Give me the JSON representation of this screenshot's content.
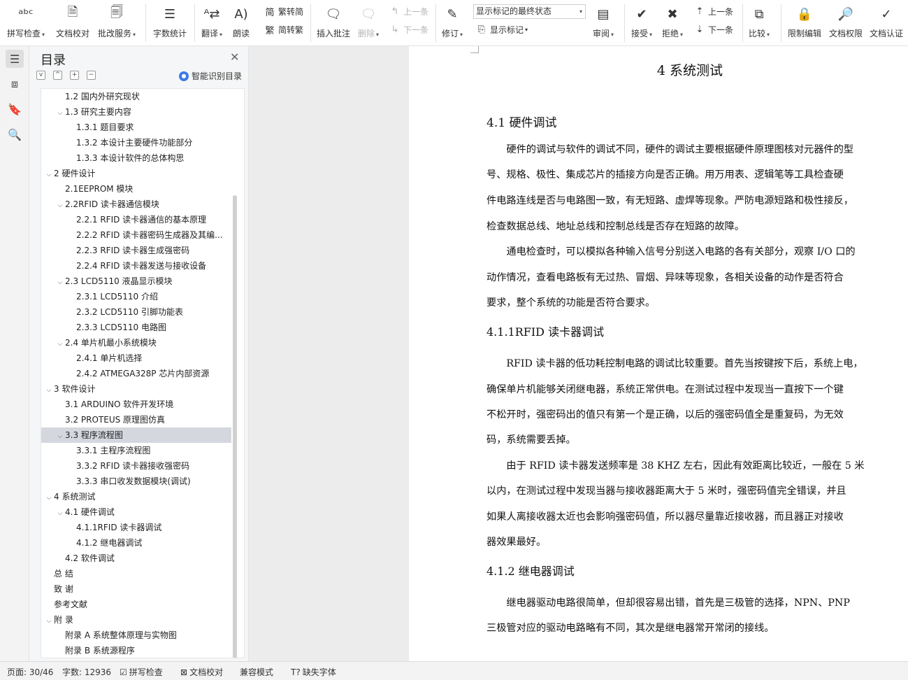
{
  "ribbon": {
    "spell": "拼写检查",
    "proof": "文档校对",
    "batch": "批改服务",
    "wordcount": "字数统计",
    "translate": "翻译",
    "read": "朗读",
    "trad": "繁转简",
    "simp": "简转繁",
    "insert_comment": "插入批注",
    "delete": "删除",
    "prev_comment": "上一条",
    "next_comment": "下一条",
    "revise": "修订",
    "display_select": "显示标记的最终状态",
    "show_markup": "显示标记",
    "review": "审阅",
    "accept": "接受",
    "reject": "拒绝",
    "prev_change": "上一条",
    "next_change": "下一条",
    "compare": "比较",
    "restrict": "限制编辑",
    "permission": "文档权限",
    "certify": "文档认证"
  },
  "toc": {
    "title": "目录",
    "smart": "智能识别目录",
    "items": [
      {
        "text": "1.2 国内外研究现状",
        "level": 1,
        "caret": ""
      },
      {
        "text": "1.3 研究主要内容",
        "level": 1,
        "caret": "v"
      },
      {
        "text": "1.3.1 题目要求",
        "level": 2,
        "caret": ""
      },
      {
        "text": "1.3.2 本设计主要硬件功能部分",
        "level": 2,
        "caret": ""
      },
      {
        "text": "1.3.3 本设计软件的总体构思",
        "level": 2,
        "caret": ""
      },
      {
        "text": "2 硬件设计",
        "level": 0,
        "caret": "v"
      },
      {
        "text": "2.1EEPROM 模块",
        "level": 1,
        "caret": ""
      },
      {
        "text": "2.2RFID 读卡器通信模块",
        "level": 1,
        "caret": "v"
      },
      {
        "text": "2.2.1 RFID 读卡器通信的基本原理",
        "level": 2,
        "caret": ""
      },
      {
        "text": "2.2.2 RFID 读卡器密码生成器及其编...",
        "level": 2,
        "caret": ""
      },
      {
        "text": "2.2.3 RFID 读卡器生成强密码",
        "level": 2,
        "caret": ""
      },
      {
        "text": "2.2.4 RFID 读卡器发送与接收设备",
        "level": 2,
        "caret": ""
      },
      {
        "text": "2.3 LCD5110 液晶显示模块",
        "level": 1,
        "caret": "v"
      },
      {
        "text": "2.3.1 LCD5110 介绍",
        "level": 2,
        "caret": ""
      },
      {
        "text": "2.3.2 LCD5110 引脚功能表",
        "level": 2,
        "caret": ""
      },
      {
        "text": "2.3.3 LCD5110 电路图",
        "level": 2,
        "caret": ""
      },
      {
        "text": "2.4 单片机最小系统模块",
        "level": 1,
        "caret": "v"
      },
      {
        "text": "2.4.1 单片机选择",
        "level": 2,
        "caret": ""
      },
      {
        "text": "2.4.2 ATMEGA328P 芯片内部资源",
        "level": 2,
        "caret": ""
      },
      {
        "text": "3 软件设计",
        "level": 0,
        "caret": "v"
      },
      {
        "text": "3.1 ARDUINO 软件开发环境",
        "level": 1,
        "caret": ""
      },
      {
        "text": "3.2 PROTEUS 原理图仿真",
        "level": 1,
        "caret": ""
      },
      {
        "text": "3.3 程序流程图",
        "level": 1,
        "caret": "v",
        "selected": true
      },
      {
        "text": "3.3.1 主程序流程图",
        "level": 2,
        "caret": ""
      },
      {
        "text": "3.3.2 RFID 读卡器接收强密码",
        "level": 2,
        "caret": ""
      },
      {
        "text": "3.3.3 串口收发数据模块(调试)",
        "level": 2,
        "caret": ""
      },
      {
        "text": "4 系统测试",
        "level": 0,
        "caret": "v"
      },
      {
        "text": "4.1 硬件调试",
        "level": 1,
        "caret": "v"
      },
      {
        "text": "4.1.1RFID 读卡器调试",
        "level": 2,
        "caret": ""
      },
      {
        "text": "4.1.2 继电器调试",
        "level": 2,
        "caret": ""
      },
      {
        "text": "4.2 软件调试",
        "level": 1,
        "caret": ""
      },
      {
        "text": "总 结",
        "level": 0,
        "caret": ""
      },
      {
        "text": "致 谢",
        "level": 0,
        "caret": ""
      },
      {
        "text": "参考文献",
        "level": 0,
        "caret": ""
      },
      {
        "text": "附 录",
        "level": 0,
        "caret": "v"
      },
      {
        "text": "附录 A 系统整体原理与实物图",
        "level": 1,
        "caret": ""
      },
      {
        "text": "附录 B 系统源程序",
        "level": 1,
        "caret": ""
      }
    ]
  },
  "doc": {
    "chapter": "4 系统测试",
    "h41": "4.1  硬件调试",
    "h411": "4.1.1RFID 读卡器调试",
    "h412": "4.1.2 继电器调试",
    "lines": [
      "　　硬件的调试与软件的调试不同，硬件的调试主要根据硬件原理图核对元器件的型",
      "号、规格、极性、集成芯片的插接方向是否正确。用万用表、逻辑笔等工具检查硬",
      "件电路连线是否与电路图一致，有无短路、虚焊等现象。严防电源短路和极性接反，",
      "检查数据总线、地址总线和控制总线是否存在短路的故障。",
      "　　通电检查时，可以模拟各种输入信号分别送入电路的各有关部分，观察 I/O 口的",
      "动作情况，查看电路板有无过热、冒烟、异味等现象，各相关设备的动作是否符合",
      "要求，整个系统的功能是否符合要求。",
      "　　RFID 读卡器的低功耗控制电路的调试比较重要。首先当按键按下后，系统上电，",
      "确保单片机能够关闭继电器，系统正常供电。在测试过程中发现当一直按下一个键",
      "不松开时，强密码出的值只有第一个是正确，以后的强密码值全是重复码，为无效",
      "码，系统需要丢掉。",
      "　　由于 RFID 读卡器发送频率是 38 KHZ 左右，因此有效距离比较近，一般在 5 米",
      "以内，在测试过程中发现当器与接收器距离大于 5 米时，强密码值完全错误，并且",
      "如果人离接收器太近也会影响强密码值，所以器尽量靠近接收器，而且器正对接收",
      "器效果最好。",
      "　　继电器驱动电路很简单，但却很容易出错，首先是三极管的选择，NPN、PNP",
      "三极管对应的驱动电路略有不同，其次是继电器常开常闭的接线。"
    ]
  },
  "status": {
    "page": "页面: 30/46",
    "words": "字数: 12936",
    "spell": "拼写检查",
    "proof": "文档校对",
    "compat": "兼容模式",
    "missing_font": "缺失字体"
  }
}
